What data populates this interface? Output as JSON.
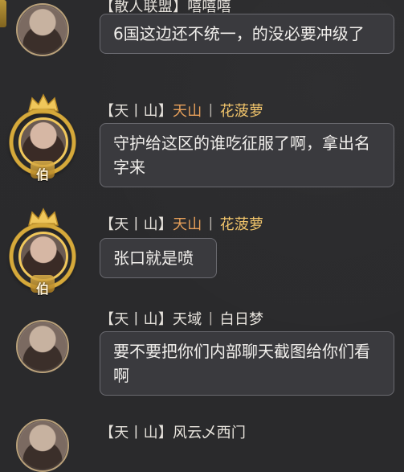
{
  "messages": [
    {
      "realm_tag": "",
      "realm": "",
      "name": "",
      "text": "6国这边还不统一，的没必要冲级了",
      "avatar_type": "standard",
      "top_partial_name": "【散人联盟】嘻嘻嘻"
    },
    {
      "realm_tag": "天丨山",
      "realm": "天山",
      "name": "花菠萝",
      "text": "守护给这区的谁吃征服了啊，拿出名字来",
      "avatar_type": "noble",
      "rank": "伯"
    },
    {
      "realm_tag": "天丨山",
      "realm": "天山",
      "name": "花菠萝",
      "text": "张口就是喷",
      "avatar_type": "noble",
      "rank": "伯"
    },
    {
      "realm_tag": "天丨山",
      "realm": "天域",
      "name": "白日梦",
      "text": "要不要把你们内部聊天截图给你们看啊",
      "avatar_type": "standard"
    },
    {
      "realm_tag": "天丨山",
      "realm": "风云",
      "name": "乄西门",
      "text": "",
      "avatar_type": "standard"
    }
  ],
  "colors": {
    "background": "#2a2a2c",
    "bubble_bg": "#3a3a3e",
    "bubble_border": "#6a6a70",
    "realm_gold": "#e7a05a",
    "name_gold": "#f2c56b",
    "noble_gold": "#d6a93a"
  },
  "icons": {
    "noble_crown": "crown-icon",
    "noble_wreath": "wreath-icon"
  }
}
